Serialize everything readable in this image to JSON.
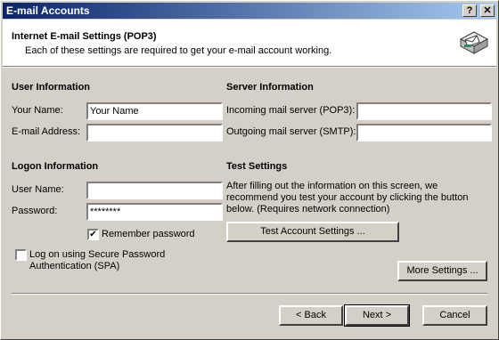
{
  "window": {
    "title": "E-mail Accounts",
    "help_button": "?",
    "close_button": "✕"
  },
  "header": {
    "title": "Internet E-mail Settings (POP3)",
    "subtitle": "Each of these settings are required to get your e-mail account working."
  },
  "user_info": {
    "heading": "User Information",
    "your_name_label": "Your Name:",
    "your_name_value": "Your Name",
    "email_label": "E-mail Address:",
    "email_value": ""
  },
  "server_info": {
    "heading": "Server Information",
    "incoming_label": "Incoming mail server (POP3):",
    "incoming_value": "",
    "outgoing_label": "Outgoing mail server (SMTP):",
    "outgoing_value": ""
  },
  "logon_info": {
    "heading": "Logon Information",
    "user_name_label": "User Name:",
    "user_name_value": "",
    "password_label": "Password:",
    "password_value": "********",
    "remember_label": "Remember password",
    "remember_checked": true,
    "spa_label_line1": "Log on using Secure Password",
    "spa_label_line2": "Authentication (SPA)",
    "spa_checked": false
  },
  "test_settings": {
    "heading": "Test Settings",
    "desc_line1": "After filling out the information on this screen, we",
    "desc_line2": "recommend you test your account by clicking the button",
    "desc_line3": "below. (Requires network connection)",
    "button": "Test Account Settings ..."
  },
  "more_settings_button": "More Settings ...",
  "footer": {
    "back": "< Back",
    "next": "Next >",
    "cancel": "Cancel"
  },
  "colors": {
    "titlebar_start": "#0a246a",
    "titlebar_end": "#a6caf0",
    "face": "#d4d0c8"
  }
}
